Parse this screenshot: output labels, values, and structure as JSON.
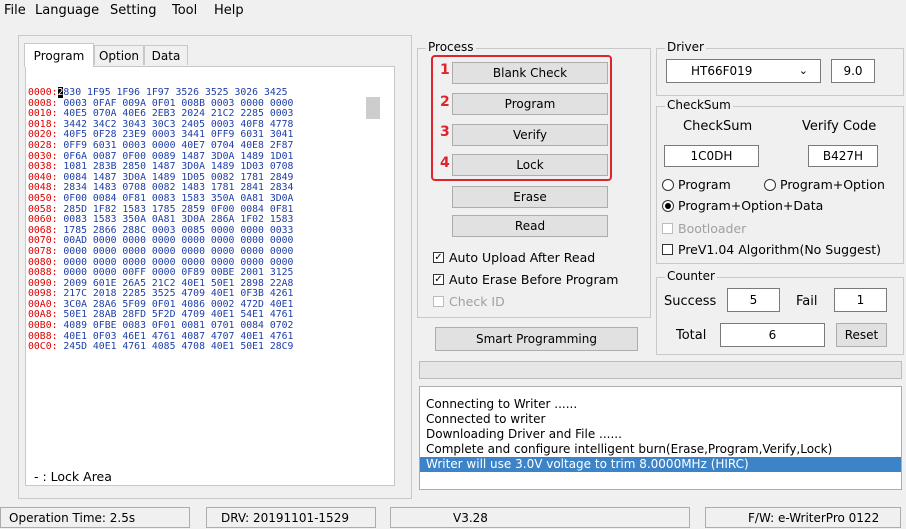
{
  "menu": [
    "File",
    "Language",
    "Setting",
    "Tool",
    "Help"
  ],
  "tabs": [
    "Program",
    "Option",
    "Data"
  ],
  "hex": {
    "cursor_char": "2",
    "rows": [
      {
        "addr": "0000:",
        "bytes": "830 1F95 1F96 1F97 3526 3525 3026 3425"
      },
      {
        "addr": "0008:",
        "bytes": "0003 0FAF 009A 0F01 008B 0003 0000 0000"
      },
      {
        "addr": "0010:",
        "bytes": "40E5 070A 40E6 2EB3 2024 21C2 2285 0003"
      },
      {
        "addr": "0018:",
        "bytes": "3442 34C2 3043 30C3 2405 0003 40F8 4778"
      },
      {
        "addr": "0020:",
        "bytes": "40F5 0F28 23E9 0003 3441 0FF9 6031 3041"
      },
      {
        "addr": "0028:",
        "bytes": "0FF9 6031 0003 0000 40E7 0704 40E8 2F87"
      },
      {
        "addr": "0030:",
        "bytes": "0F6A 0087 0F00 0089 1487 3D0A 1489 1D01"
      },
      {
        "addr": "0038:",
        "bytes": "1081 283B 2850 1487 3D0A 1489 1D03 0708"
      },
      {
        "addr": "0040:",
        "bytes": "0084 1487 3D0A 1489 1D05 0082 1781 2849"
      },
      {
        "addr": "0048:",
        "bytes": "2834 1483 0708 0082 1483 1781 2841 2834"
      },
      {
        "addr": "0050:",
        "bytes": "0F00 0084 0F81 0083 1583 350A 0A81 3D0A"
      },
      {
        "addr": "0058:",
        "bytes": "285D 1F82 1583 1785 2859 0F00 0084 0F81"
      },
      {
        "addr": "0060:",
        "bytes": "0083 1583 350A 0A81 3D0A 286A 1F02 1583"
      },
      {
        "addr": "0068:",
        "bytes": "1785 2866 288C 0003 0085 0000 0000 0033"
      },
      {
        "addr": "0070:",
        "bytes": "00AD 0000 0000 0000 0000 0000 0000 0000"
      },
      {
        "addr": "0078:",
        "bytes": "0000 0000 0000 0000 0000 0000 0000 0000"
      },
      {
        "addr": "0080:",
        "bytes": "0000 0000 0000 0000 0000 0000 0000 0000"
      },
      {
        "addr": "0088:",
        "bytes": "0000 0000 00FF 0000 0F89 00BE 2001 3125"
      },
      {
        "addr": "0090:",
        "bytes": "2009 601E 26A5 21C2 40E1 50E1 2898 22A8"
      },
      {
        "addr": "0098:",
        "bytes": "217C 2018 2285 3525 4709 40E1 0F3B 4261"
      },
      {
        "addr": "00A0:",
        "bytes": "3C0A 28A6 5F09 0F01 4086 0002 472D 40E1"
      },
      {
        "addr": "00A8:",
        "bytes": "50E1 28AB 28FD 5F2D 4709 40E1 54E1 4761"
      },
      {
        "addr": "00B0:",
        "bytes": "4089 0FBE 0083 0F01 0081 0701 0084 0702"
      },
      {
        "addr": "00B8:",
        "bytes": "40E1 0F03 46E1 4761 4087 4707 40E1 4761"
      },
      {
        "addr": "00C0:",
        "bytes": "245D 40E1 4761 4085 4708 40E1 50E1 28C9"
      }
    ],
    "legend": "- : Lock Area"
  },
  "process": {
    "title": "Process",
    "numbers": [
      "1",
      "2",
      "3",
      "4"
    ],
    "blank_check": "Blank Check",
    "program": "Program",
    "verify": "Verify",
    "lock": "Lock",
    "erase": "Erase",
    "read": "Read",
    "auto_upload": "Auto Upload After Read",
    "auto_erase": "Auto Erase Before Program",
    "check_id": "Check ID",
    "smart": "Smart Programming"
  },
  "driver": {
    "title": "Driver",
    "selected": "HT66F019",
    "version": "9.0"
  },
  "checksum": {
    "title": "CheckSum",
    "col_checksum": "CheckSum",
    "col_verify": "Verify Code",
    "checksum_value": "1C0DH",
    "verify_value": "B427H",
    "radio_program": "Program",
    "radio_program_option": "Program+Option",
    "radio_all": "Program+Option+Data",
    "bootloader": "Bootloader",
    "prev104": "PreV1.04 Algorithm(No Suggest)"
  },
  "counter": {
    "title": "Counter",
    "success_label": "Success",
    "success_value": "5",
    "fail_label": "Fail",
    "fail_value": "1",
    "total_label": "Total",
    "total_value": "6",
    "reset": "Reset"
  },
  "log": [
    "Connecting to Writer ......",
    "Connected to writer",
    "Downloading Driver and File ......",
    "Complete and configure intelligent burn(Erase,Program,Verify,Lock)",
    "Writer will use 3.0V voltage to trim 8.0000MHz (HIRC)"
  ],
  "status": {
    "operation_time": "Operation Time: 2.5s",
    "drv": "DRV: 20191101-1529",
    "version": "V3.28",
    "fw": "F/W: e-WriterPro 0122"
  },
  "colors": {
    "highlight_red": "#e0242b",
    "selection_blue": "#3c83c8",
    "hex_address": "#e00000",
    "hex_bytes": "#1e3ea8"
  }
}
